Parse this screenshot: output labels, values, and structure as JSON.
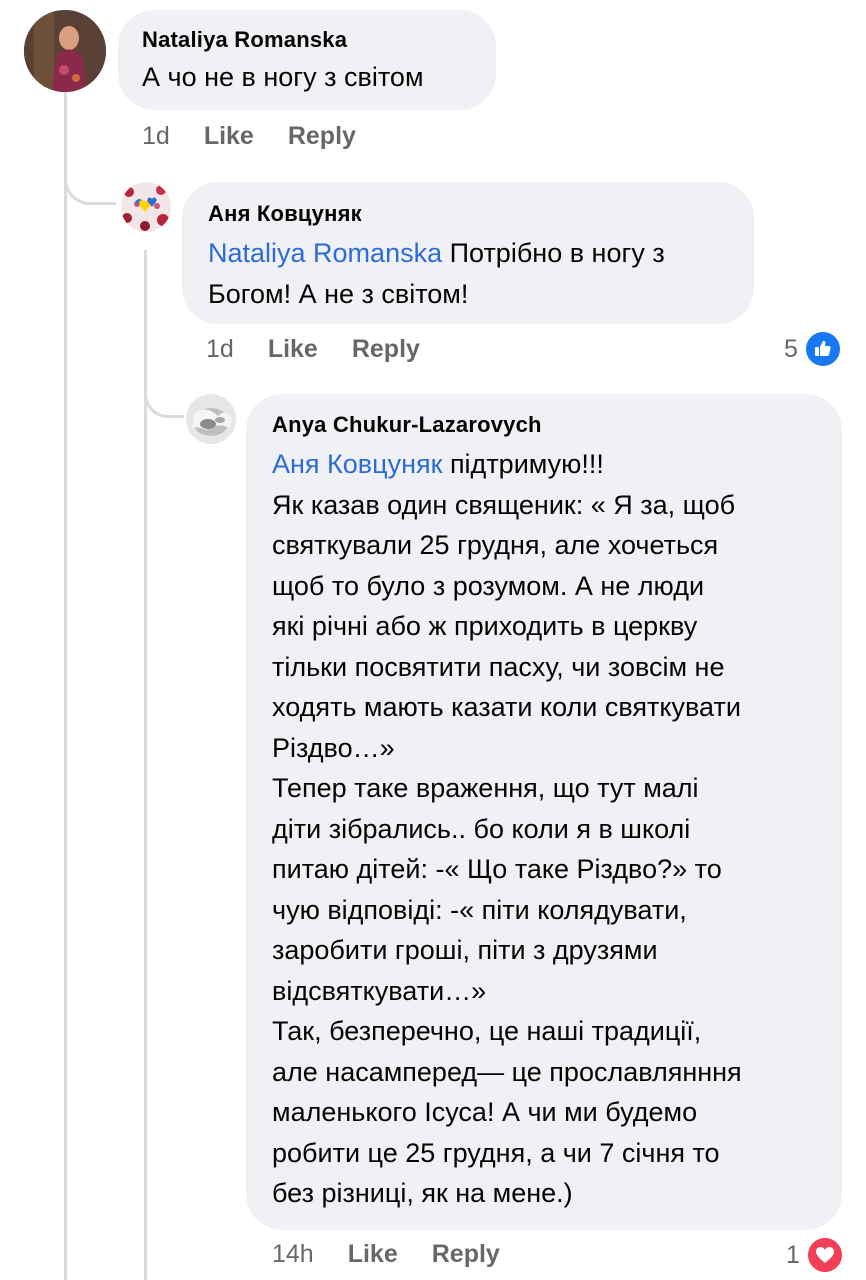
{
  "colors": {
    "bubble": "#eff1f4",
    "mention": "#2d6bd6",
    "meta": "#65676b",
    "like_reaction": "#1877f2",
    "love_reaction": "#f33e58"
  },
  "comments": [
    {
      "author": "Nataliya Romanska",
      "text": "А чо не в ногу з світом",
      "time": "1d",
      "like_label": "Like",
      "reply_label": "Reply"
    },
    {
      "author": "Аня Ковцуняк",
      "mention": "Nataliya Romanska",
      "text_line1": " Потрібно в ногу з",
      "text_line2": "Богом! А не з світом!",
      "time": "1d",
      "like_label": "Like",
      "reply_label": "Reply",
      "reaction_count": "5",
      "reaction_icon": "like-icon"
    },
    {
      "author": "Anya Chukur-Lazarovych",
      "mention": "Аня Ковцуняк",
      "lines": [
        " підтримую!!!",
        "Як казав один священик: « Я за, щоб",
        "святкували 25 грудня, але хочеться",
        "щоб то було з розумом. А не люди",
        "які річні або ж приходить в церкву",
        "тільки посвятити пасху, чи зовсім не",
        "ходять мають казати коли святкувати",
        "Різдво…»",
        "Тепер таке враження, що тут малі",
        "діти зібрались.. бо коли я в школі",
        "питаю дітей: -« Що таке Різдво?» то",
        "чую відповіді: -« піти колядувати,",
        "заробити гроші, піти з друзями",
        "відсвяткувати…»",
        "Так, безперечно, це наші традиції,",
        "але насамперед— це прославлянння",
        "маленького Ісуса! А чи ми будемо",
        "робити це 25 грудня, а чи 7 січня то",
        "без різниці, як на мене.)"
      ],
      "time": "14h",
      "like_label": "Like",
      "reply_label": "Reply",
      "reaction_count": "1",
      "reaction_icon": "heart-icon"
    }
  ]
}
